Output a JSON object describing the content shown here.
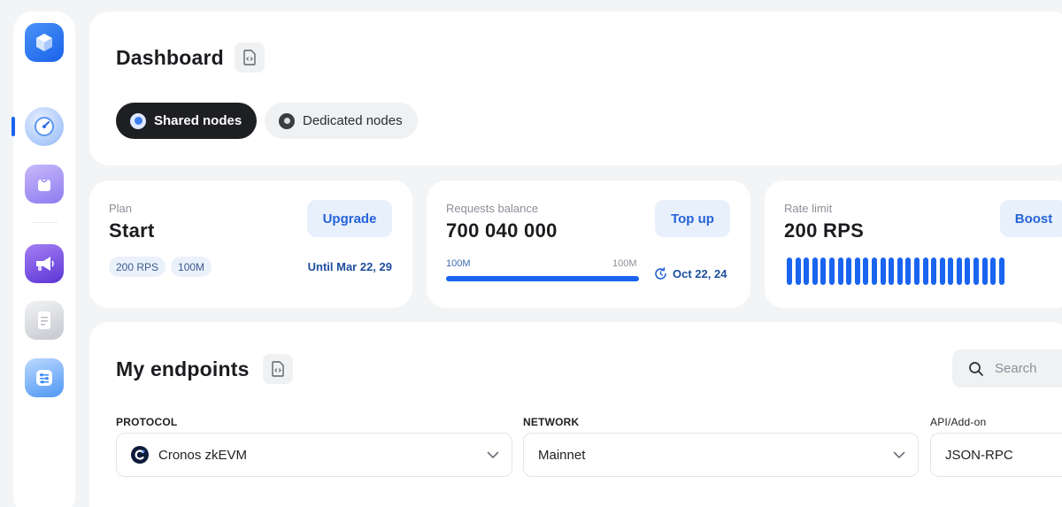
{
  "sidebar": {
    "items": [
      {
        "icon": "cube-logo-icon",
        "color": "#1e73f0"
      },
      {
        "icon": "speedometer-icon",
        "color": "#4a8cf5",
        "active": true
      },
      {
        "icon": "shopping-bag-icon",
        "color": "#9a86f2"
      },
      {
        "icon": "megaphone-icon",
        "color": "#7b4de3"
      },
      {
        "icon": "document-icon",
        "color": "#b8bcc4"
      },
      {
        "icon": "settings-sliders-icon",
        "color": "#3d8df2"
      }
    ]
  },
  "header": {
    "title": "Dashboard",
    "doc_icon": "code-document-icon",
    "tabs": [
      {
        "label": "Shared nodes",
        "active": true
      },
      {
        "label": "Dedicated nodes",
        "active": false
      }
    ]
  },
  "plan_card": {
    "label": "Plan",
    "value": "Start",
    "button": "Upgrade",
    "chips": [
      "200 RPS",
      "100M"
    ],
    "until": "Until Mar 22, 29"
  },
  "requests_card": {
    "label": "Requests balance",
    "value": "700 040 000",
    "button": "Top up",
    "progress_left": "100M",
    "progress_right": "100M",
    "progress_fraction": 1.0,
    "date": "Oct 22, 24"
  },
  "rate_card": {
    "label": "Rate limit",
    "value": "200 RPS",
    "button": "Boost",
    "bar_count": 26
  },
  "endpoints": {
    "title": "My endpoints",
    "search_placeholder": "Search",
    "protocol_label": "PROTOCOL",
    "protocol_value": "Cronos zkEVM",
    "network_label": "NETWORK",
    "network_value": "Mainnet",
    "api_label": "API/Add-on",
    "api_value": "JSON-RPC"
  },
  "colors": {
    "accent": "#1a64f0",
    "dark_pill": "#1e1f22",
    "chip_bg": "#eaf1fb"
  }
}
